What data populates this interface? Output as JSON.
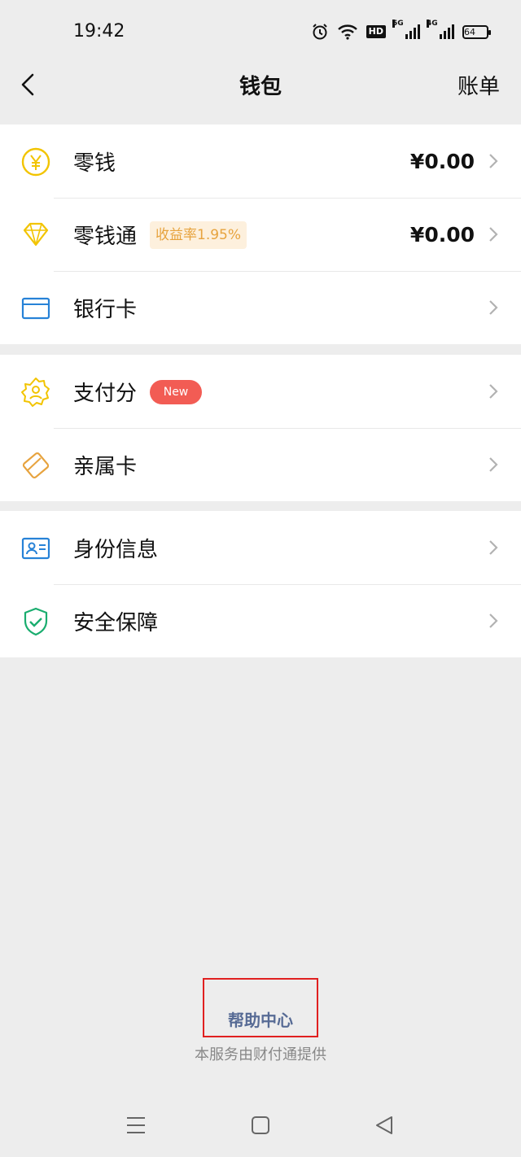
{
  "status_bar": {
    "time": "19:42",
    "hd_label": "HD",
    "sig5g_label": "5G",
    "sig4g_label": "4G",
    "battery": "64"
  },
  "nav": {
    "title": "钱包",
    "bill_label": "账单"
  },
  "groups": [
    {
      "items": [
        {
          "label": "零钱",
          "amount": "¥0.00",
          "icon": "yuan-icon"
        },
        {
          "label": "零钱通",
          "tag": "收益率1.95%",
          "amount": "¥0.00",
          "icon": "diamond-icon"
        },
        {
          "label": "银行卡",
          "icon": "bank-card-icon"
        }
      ]
    },
    {
      "items": [
        {
          "label": "支付分",
          "badge": "New",
          "icon": "pay-score-icon"
        },
        {
          "label": "亲属卡",
          "icon": "family-card-icon"
        }
      ]
    },
    {
      "items": [
        {
          "label": "身份信息",
          "icon": "id-card-icon"
        },
        {
          "label": "安全保障",
          "icon": "security-shield-icon"
        }
      ]
    }
  ],
  "footer": {
    "help_center": "帮助中心",
    "provider": "本服务由财付通提供"
  },
  "colors": {
    "yellow": "#f2c400",
    "orange": "#e7a33e",
    "blue": "#2782d7",
    "green": "#1aad6f",
    "link": "#576b95",
    "highlight": "#e02020"
  }
}
